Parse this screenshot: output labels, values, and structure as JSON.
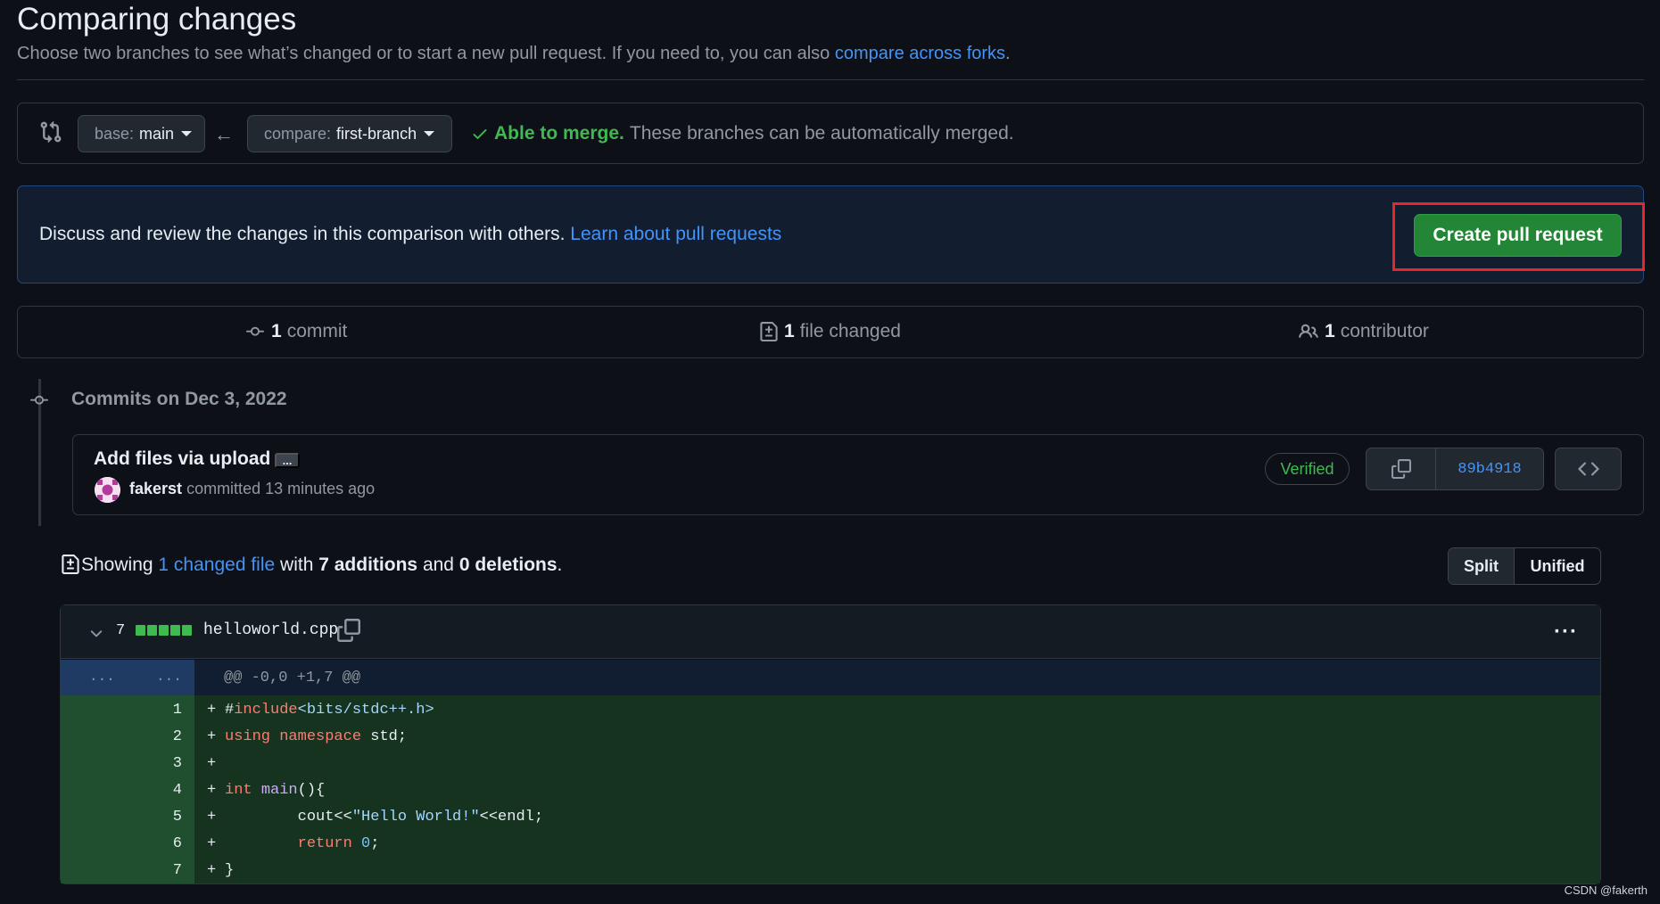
{
  "header": {
    "title": "Comparing changes",
    "description_prefix": "Choose two branches to see what’s changed or to start a new pull request. If you need to, you can also",
    "description_link": "compare across forks",
    "description_suffix": "."
  },
  "range": {
    "base_label": "base:",
    "base_value": "main",
    "compare_label": "compare:",
    "compare_value": "first-branch",
    "merge_ok": "Able to merge.",
    "merge_message": "These branches can be automatically merged."
  },
  "discuss": {
    "text": "Discuss and review the changes in this comparison with others.",
    "link": "Learn about pull requests",
    "button": "Create pull request"
  },
  "summary": {
    "commits_count": "1",
    "commits_label": "commit",
    "files_count": "1",
    "files_label": "file changed",
    "contributors_count": "1",
    "contributors_label": "contributor"
  },
  "timeline": {
    "date_heading": "Commits on Dec 3, 2022"
  },
  "commit": {
    "title": "Add files via upload",
    "ellipsis": "...",
    "author": "fakerst",
    "action": "committed 13 minutes ago",
    "verified": "Verified",
    "sha": "89b4918"
  },
  "diff_summary": {
    "prefix": "Showing",
    "files_link": "1 changed file",
    "with": "with",
    "additions": "7 additions",
    "and": "and",
    "deletions": "0 deletions",
    "suffix": ".",
    "split_label": "Split",
    "unified_label": "Unified"
  },
  "file": {
    "diffstat": "7",
    "additions_blocks": 5,
    "name": "helloworld.cpp",
    "hunk_dots_left": "...",
    "hunk_dots_right": "...",
    "hunk_header": "@@ -0,0 +1,7 @@",
    "lines": [
      {
        "num": "1",
        "sign": "+",
        "text": "#include<bits/stdc++.h>"
      },
      {
        "num": "2",
        "sign": "+",
        "text": "using namespace std;"
      },
      {
        "num": "3",
        "sign": "+",
        "text": ""
      },
      {
        "num": "4",
        "sign": "+",
        "text": "int main(){"
      },
      {
        "num": "5",
        "sign": "+",
        "text": "        cout<<\"Hello World!\"<<endl;"
      },
      {
        "num": "6",
        "sign": "+",
        "text": "        return 0;"
      },
      {
        "num": "7",
        "sign": "+",
        "text": "}"
      }
    ]
  },
  "watermark": "CSDN @fakerth",
  "colors": {
    "accent": "#4493f8",
    "success": "#3fb950",
    "button_green": "#238636",
    "highlight_red": "#e5272d"
  }
}
